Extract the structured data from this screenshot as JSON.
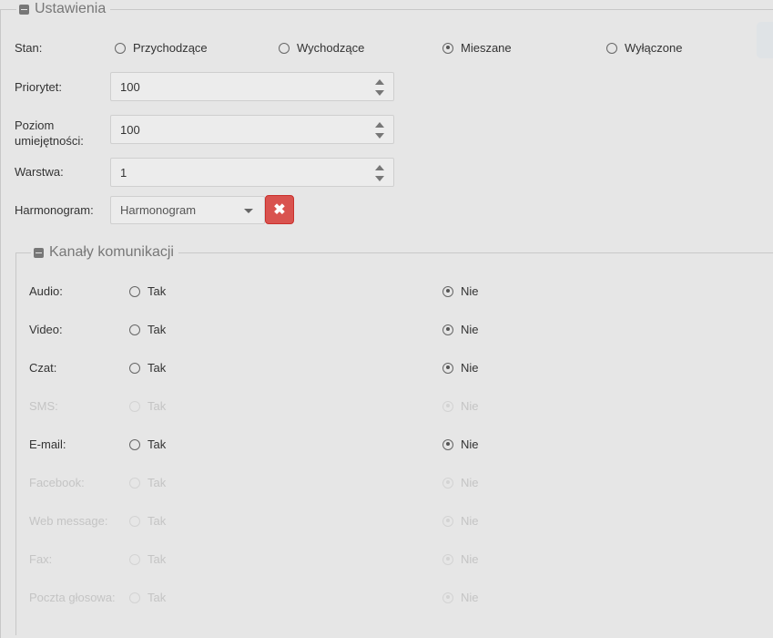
{
  "settings": {
    "legend": "Ustawienia",
    "state": {
      "label": "Stan:",
      "options": [
        {
          "label": "Przychodzące",
          "checked": false
        },
        {
          "label": "Wychodzące",
          "checked": false
        },
        {
          "label": "Mieszane",
          "checked": true
        },
        {
          "label": "Wyłączone",
          "checked": false
        }
      ]
    },
    "priority": {
      "label": "Priorytet:",
      "value": "100"
    },
    "skill": {
      "label_line1": "Poziom",
      "label_line2": "umiejętności:",
      "value": "100"
    },
    "layer": {
      "label": "Warstwa:",
      "value": "1"
    },
    "schedule": {
      "label": "Harmonogram:",
      "selected": "Harmonogram",
      "clear_icon": "times-icon"
    }
  },
  "channels": {
    "legend": "Kanały komunikacji",
    "yes_label": "Tak",
    "no_label": "Nie",
    "items": [
      {
        "label": "Audio:",
        "disabled": false
      },
      {
        "label": "Video:",
        "disabled": false
      },
      {
        "label": "Czat:",
        "disabled": false
      },
      {
        "label": "SMS:",
        "disabled": true
      },
      {
        "label": "E-mail:",
        "disabled": false
      },
      {
        "label": "Facebook:",
        "disabled": true
      },
      {
        "label": "Web message:",
        "disabled": true
      },
      {
        "label": "Fax:",
        "disabled": true
      },
      {
        "label": "Poczta głosowa:",
        "disabled": true
      }
    ]
  }
}
